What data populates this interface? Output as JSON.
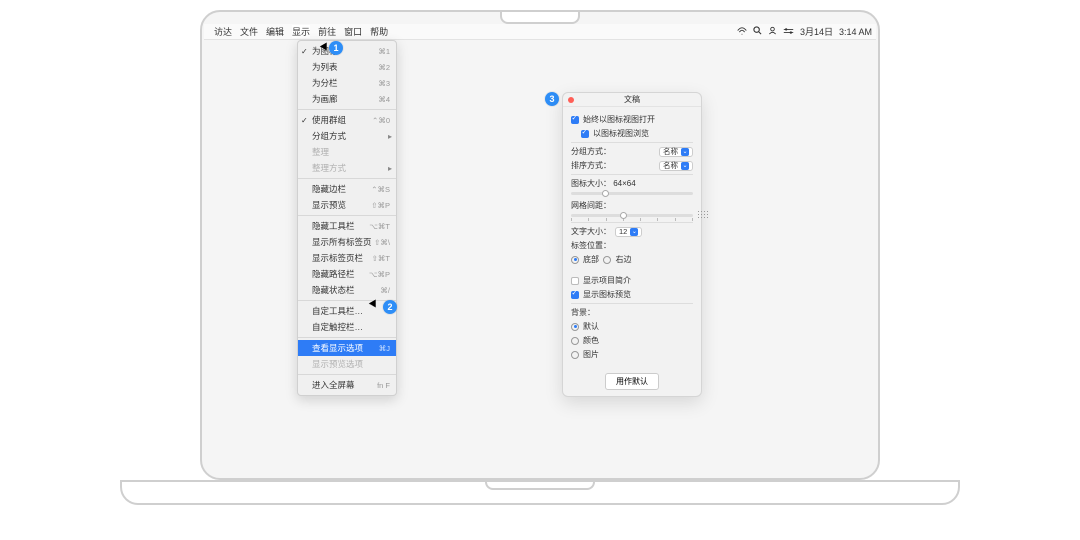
{
  "menubar": {
    "app": "访达",
    "items": [
      "文件",
      "编辑",
      "显示",
      "前往",
      "窗口",
      "帮助"
    ],
    "right": {
      "date": "3月14日",
      "time": "3:14 AM"
    }
  },
  "dropdown": {
    "groups": [
      [
        {
          "label": "为图标",
          "sc": "⌘1",
          "checked": true
        },
        {
          "label": "为列表",
          "sc": "⌘2"
        },
        {
          "label": "为分栏",
          "sc": "⌘3"
        },
        {
          "label": "为画廊",
          "sc": "⌘4"
        }
      ],
      [
        {
          "label": "使用群组",
          "sc": "⌃⌘0",
          "checked": true
        },
        {
          "label": "分组方式",
          "submenu": true
        },
        {
          "label": "整理",
          "disabled": true
        },
        {
          "label": "整理方式",
          "submenu": true,
          "disabled": true
        }
      ],
      [
        {
          "label": "隐藏边栏",
          "sc": "⌃⌘S"
        },
        {
          "label": "显示预览",
          "sc": "⇧⌘P"
        }
      ],
      [
        {
          "label": "隐藏工具栏",
          "sc": "⌥⌘T"
        },
        {
          "label": "显示所有标签页",
          "sc": "⇧⌘\\"
        },
        {
          "label": "显示标签页栏",
          "sc": "⇧⌘T"
        },
        {
          "label": "隐藏路径栏",
          "sc": "⌥⌘P"
        },
        {
          "label": "隐藏状态栏",
          "sc": "⌘/"
        }
      ],
      [
        {
          "label": "自定工具栏…"
        },
        {
          "label": "自定触控栏…"
        }
      ],
      [
        {
          "label": "查看显示选项",
          "sc": "⌘J",
          "selected": true
        },
        {
          "label": "显示预览选项",
          "disabled": true
        }
      ],
      [
        {
          "label": "进入全屏幕",
          "sc": "fn F"
        }
      ]
    ]
  },
  "badges": {
    "b1": "1",
    "b2": "2",
    "b3": "3"
  },
  "panel": {
    "title": "文稿",
    "always_icon": "始终以图标视图打开",
    "browse_icon": "以图标视图浏览",
    "group_by_label": "分组方式：",
    "group_by_value": "名称",
    "sort_by_label": "排序方式：",
    "sort_by_value": "名称",
    "icon_size_label": "图标大小：",
    "icon_size_value": "64×64",
    "grid_spacing": "网格间距：",
    "text_size_label": "文字大小：",
    "text_size_value": "12",
    "label_pos": "标签位置：",
    "label_bottom": "底部",
    "label_right": "右边",
    "show_info": "显示项目简介",
    "show_preview": "显示图标预览",
    "background": "背景：",
    "bg_default": "默认",
    "bg_color": "颜色",
    "bg_picture": "图片",
    "use_default": "用作默认"
  }
}
